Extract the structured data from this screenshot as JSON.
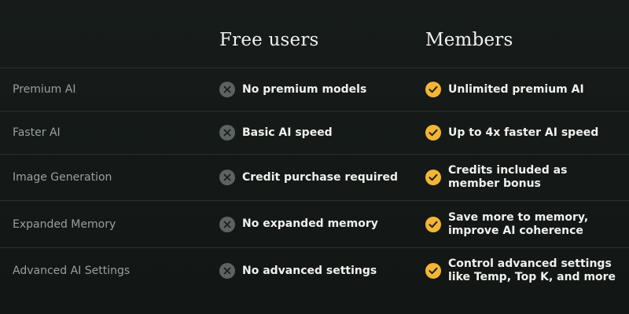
{
  "headers": {
    "free": "Free users",
    "members": "Members"
  },
  "rows": [
    {
      "feature": "Premium AI",
      "free_text": "No premium models",
      "member_text": "Unlimited premium AI"
    },
    {
      "feature": "Faster AI",
      "free_text": "Basic AI speed",
      "member_text": "Up to 4x faster AI speed"
    },
    {
      "feature": "Image Generation",
      "free_text": "Credit purchase required",
      "member_text": "Credits included as member bonus"
    },
    {
      "feature": "Expanded Memory",
      "free_text": "No expanded memory",
      "member_text": "Save more to memory, improve AI coherence"
    },
    {
      "feature": "Advanced AI Settings",
      "free_text": "No advanced settings",
      "member_text": "Control advanced settings like Temp, Top K, and more"
    }
  ],
  "icons": {
    "free": "x-circle-icon",
    "members": "check-circle-icon"
  },
  "colors": {
    "accent": "#f3b534",
    "x_icon_bg": "#5c6360",
    "background": "#161b19",
    "feature_text": "#9aa09c"
  }
}
